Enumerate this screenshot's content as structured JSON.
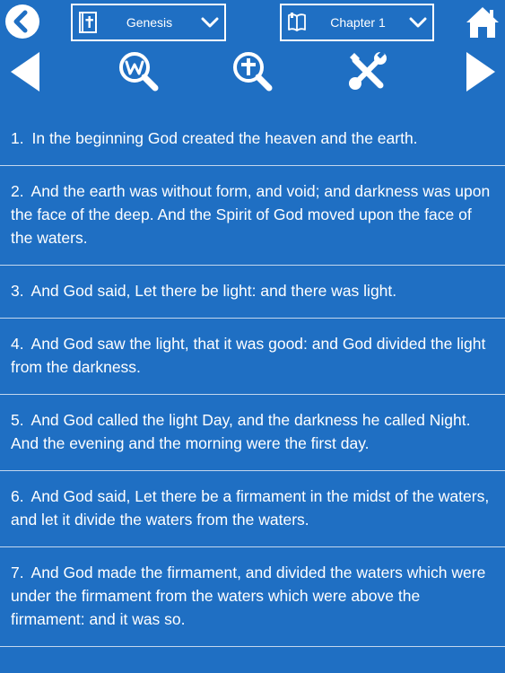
{
  "topbar": {
    "book_label": "Genesis",
    "chapter_label": "Chapter 1"
  },
  "colors": {
    "background": "#1f6fc3",
    "divider": "#c3d7ee",
    "foreground": "#ffffff"
  },
  "icons": {
    "back": "back-circle-icon",
    "book": "bible-cross-icon",
    "chapter": "open-book-icon",
    "home": "home-icon",
    "prev": "triangle-left-icon",
    "wiki": "magnifier-w-icon",
    "search": "magnifier-cross-icon",
    "settings": "wrench-screwdriver-icon",
    "next": "triangle-right-icon"
  },
  "verses": [
    {
      "num": "1.",
      "text": "In the beginning God created the heaven and the earth."
    },
    {
      "num": "2.",
      "text": "And the earth was without form, and void; and darkness was upon the face of the deep. And the Spirit of God moved upon the face of the waters."
    },
    {
      "num": "3.",
      "text": "And God said, Let there be light: and there was light."
    },
    {
      "num": "4.",
      "text": "And God saw the light, that it was good: and God divided the light from the darkness."
    },
    {
      "num": "5.",
      "text": "And God called the light Day, and the darkness he called Night. And the evening and the morning were the first day."
    },
    {
      "num": "6.",
      "text": "And God said, Let there be a firmament in the midst of the waters, and let it divide the waters from the waters."
    },
    {
      "num": "7.",
      "text": "And God made the firmament, and divided the waters which were under the firmament from the waters which were above the firmament: and it was so."
    }
  ]
}
